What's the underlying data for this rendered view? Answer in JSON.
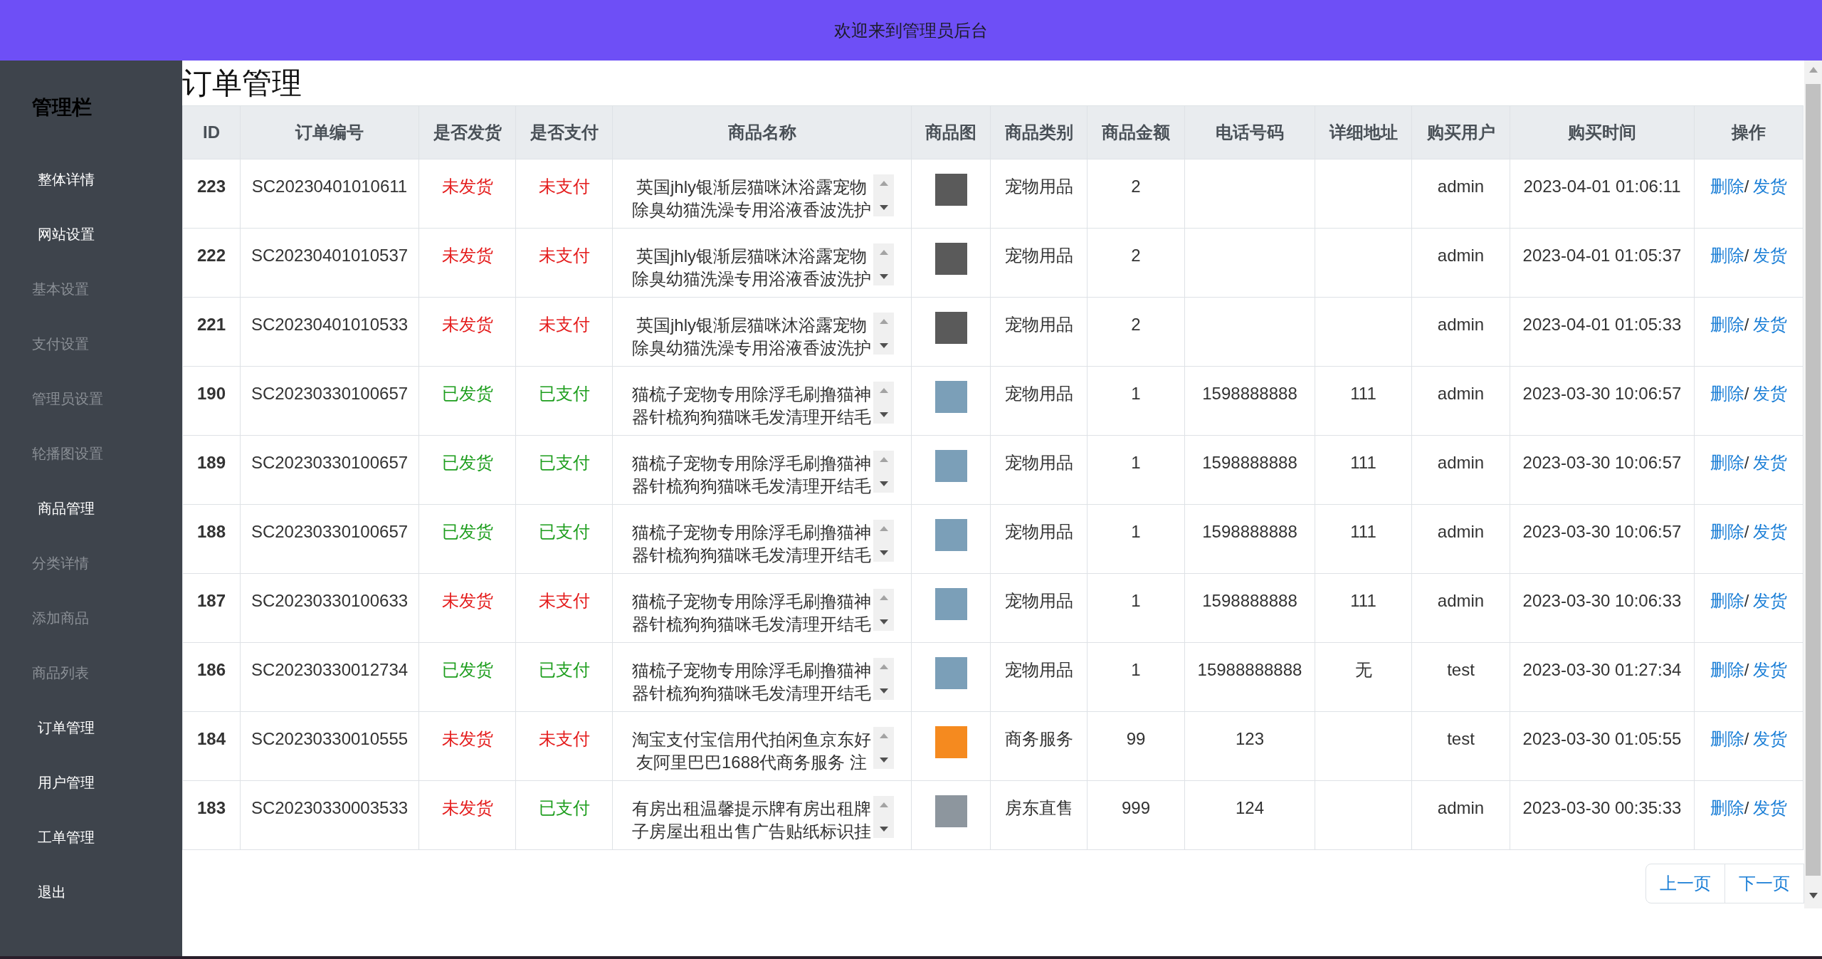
{
  "top_bar": {
    "title": "欢迎来到管理员后台"
  },
  "sidebar": {
    "title": "管理栏",
    "items": [
      {
        "label": "整体详情"
      },
      {
        "label": "网站设置",
        "children": [
          {
            "label": "基本设置"
          },
          {
            "label": "支付设置"
          },
          {
            "label": "管理员设置"
          },
          {
            "label": "轮播图设置"
          }
        ]
      },
      {
        "label": "商品管理",
        "children": [
          {
            "label": "分类详情"
          },
          {
            "label": "添加商品"
          },
          {
            "label": "商品列表"
          }
        ]
      },
      {
        "label": "订单管理"
      },
      {
        "label": "用户管理"
      },
      {
        "label": "工单管理"
      },
      {
        "label": "退出"
      }
    ]
  },
  "page": {
    "title": "订单管理"
  },
  "table": {
    "columns": [
      "ID",
      "订单编号",
      "是否发货",
      "是否支付",
      "商品名称",
      "商品图",
      "商品类别",
      "商品金额",
      "电话号码",
      "详细地址",
      "购买用户",
      "购买时间",
      "操作"
    ],
    "rows": [
      {
        "id": "223",
        "order_no": "SC20230401010611",
        "shipping": "未发货",
        "shipped": false,
        "payment": "未支付",
        "paid": false,
        "product_name": "英国jhly银渐层猫咪沐浴露宠物除臭幼猫洗澡专用浴液香波洗护",
        "image": {
          "color": "#5a5a5a"
        },
        "category": "宠物用品",
        "amount": "2",
        "user": "admin",
        "time": "2023-04-01 01:06:11",
        "actions": [
          {
            "kind": "link",
            "text": "删除"
          },
          {
            "kind": "separator",
            "text": "/"
          },
          {
            "kind": "link",
            "text": "发货"
          }
        ]
      },
      {
        "id": "222",
        "order_no": "SC20230401010537",
        "shipping": "未发货",
        "shipped": false,
        "payment": "未支付",
        "paid": false,
        "product_name": "英国jhly银渐层猫咪沐浴露宠物除臭幼猫洗澡专用浴液香波洗护",
        "image": {
          "color": "#5a5a5a"
        },
        "category": "宠物用品",
        "amount": "2",
        "user": "admin",
        "time": "2023-04-01 01:05:37",
        "actions": [
          {
            "kind": "link",
            "text": "删除"
          },
          {
            "kind": "separator",
            "text": "/"
          },
          {
            "kind": "link",
            "text": "发货"
          }
        ]
      },
      {
        "id": "221",
        "order_no": "SC20230401010533",
        "shipping": "未发货",
        "shipped": false,
        "payment": "未支付",
        "paid": false,
        "product_name": "英国jhly银渐层猫咪沐浴露宠物除臭幼猫洗澡专用浴液香波洗护",
        "image": {
          "color": "#5a5a5a"
        },
        "category": "宠物用品",
        "amount": "2",
        "user": "admin",
        "time": "2023-04-01 01:05:33",
        "actions": [
          {
            "kind": "link",
            "text": "删除"
          },
          {
            "kind": "separator",
            "text": "/"
          },
          {
            "kind": "link",
            "text": "发货"
          }
        ]
      },
      {
        "id": "190",
        "order_no": "SC20230330100657",
        "shipping": "已发货",
        "shipped": true,
        "payment": "已支付",
        "paid": true,
        "product_name": "猫梳子宠物专用除浮毛刷撸猫神器针梳狗狗猫咪毛发清理开结毛",
        "image": {
          "color": "#7b9fb8"
        },
        "category": "宠物用品",
        "amount": "1",
        "phone": "1598888888",
        "address": "111",
        "user": "admin",
        "time": "2023-03-30 10:06:57",
        "actions": [
          {
            "kind": "link",
            "text": "删除"
          },
          {
            "kind": "separator",
            "text": "/"
          },
          {
            "kind": "link",
            "text": "发货"
          }
        ]
      },
      {
        "id": "189",
        "order_no": "SC20230330100657",
        "shipping": "已发货",
        "shipped": true,
        "payment": "已支付",
        "paid": true,
        "product_name": "猫梳子宠物专用除浮毛刷撸猫神器针梳狗狗猫咪毛发清理开结毛",
        "image": {
          "color": "#7b9fb8"
        },
        "category": "宠物用品",
        "amount": "1",
        "phone": "1598888888",
        "address": "111",
        "user": "admin",
        "time": "2023-03-30 10:06:57",
        "actions": [
          {
            "kind": "link",
            "text": "删除"
          },
          {
            "kind": "separator",
            "text": "/"
          },
          {
            "kind": "link",
            "text": "发货"
          }
        ]
      },
      {
        "id": "188",
        "order_no": "SC20230330100657",
        "shipping": "已发货",
        "shipped": true,
        "payment": "已支付",
        "paid": true,
        "product_name": "猫梳子宠物专用除浮毛刷撸猫神器针梳狗狗猫咪毛发清理开结毛",
        "image": {
          "color": "#7b9fb8"
        },
        "category": "宠物用品",
        "amount": "1",
        "phone": "1598888888",
        "address": "111",
        "user": "admin",
        "time": "2023-03-30 10:06:57",
        "actions": [
          {
            "kind": "link",
            "text": "删除"
          },
          {
            "kind": "separator",
            "text": "/"
          },
          {
            "kind": "link",
            "text": "发货"
          }
        ]
      },
      {
        "id": "187",
        "order_no": "SC20230330100633",
        "shipping": "未发货",
        "shipped": false,
        "payment": "未支付",
        "paid": false,
        "product_name": "猫梳子宠物专用除浮毛刷撸猫神器针梳狗狗猫咪毛发清理开结毛",
        "image": {
          "color": "#7b9fb8"
        },
        "category": "宠物用品",
        "amount": "1",
        "phone": "1598888888",
        "address": "111",
        "user": "admin",
        "time": "2023-03-30 10:06:33",
        "actions": [
          {
            "kind": "link",
            "text": "删除"
          },
          {
            "kind": "separator",
            "text": "/"
          },
          {
            "kind": "link",
            "text": "发货"
          }
        ]
      },
      {
        "id": "186",
        "order_no": "SC20230330012734",
        "shipping": "已发货",
        "shipped": true,
        "payment": "已支付",
        "paid": true,
        "product_name": "猫梳子宠物专用除浮毛刷撸猫神器针梳狗狗猫咪毛发清理开结毛",
        "image": {
          "color": "#7b9fb8"
        },
        "category": "宠物用品",
        "amount": "1",
        "phone": "15988888888",
        "address": "无",
        "user": "test",
        "time": "2023-03-30 01:27:34",
        "actions": [
          {
            "kind": "link",
            "text": "删除"
          },
          {
            "kind": "separator",
            "text": "/"
          },
          {
            "kind": "link",
            "text": "发货"
          }
        ]
      },
      {
        "id": "184",
        "order_no": "SC20230330010555",
        "shipping": "未发货",
        "shipped": false,
        "payment": "未支付",
        "paid": false,
        "product_name": "淘宝支付宝信用代拍闲鱼京东好友阿里巴巴1688代商务服务 注",
        "image": {
          "color": "#f58a1f"
        },
        "category": "商务服务",
        "amount": "99",
        "phone": "123",
        "user": "test",
        "time": "2023-03-30 01:05:55",
        "actions": [
          {
            "kind": "link",
            "text": "删除"
          },
          {
            "kind": "separator",
            "text": "/"
          },
          {
            "kind": "link",
            "text": "发货"
          }
        ]
      },
      {
        "id": "183",
        "order_no": "SC20230330003533",
        "shipping": "未发货",
        "shipped": false,
        "payment": "已支付",
        "paid": true,
        "product_name": "有房出租温馨提示牌有房出租牌子房屋出租出售广告贴纸标识挂",
        "image": {
          "color": "#8d969e"
        },
        "category": "房东直售",
        "amount": "999",
        "phone": "124",
        "user": "admin",
        "time": "2023-03-30 00:35:33",
        "actions": [
          {
            "kind": "link",
            "text": "删除"
          },
          {
            "kind": "separator",
            "text": "/"
          },
          {
            "kind": "link",
            "text": "发货"
          }
        ]
      }
    ]
  },
  "pagination": {
    "buttons": [
      "上一页",
      "下一页"
    ]
  }
}
